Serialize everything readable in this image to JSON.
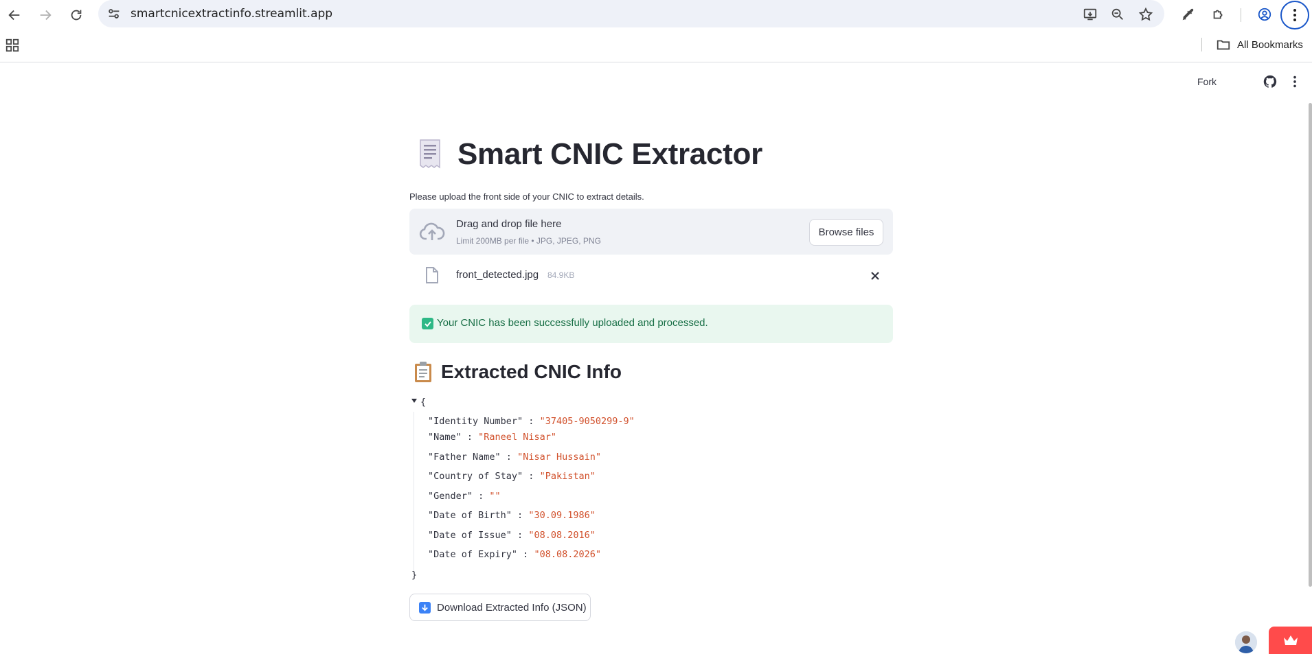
{
  "browser": {
    "url": "smartcnicextractinfo.streamlit.app",
    "bookmarks_label": "All Bookmarks"
  },
  "toolbar": {
    "fork_label": "Fork"
  },
  "page": {
    "title": "Smart CNIC Extractor",
    "subtitle": "Please upload the front side of your CNIC to extract details."
  },
  "uploader": {
    "drop_label": "Drag and drop file here",
    "limit_label": "Limit 200MB per file • JPG, JPEG, PNG",
    "browse_label": "Browse files"
  },
  "file": {
    "name": "front_detected.jpg",
    "size": "84.9KB"
  },
  "success_message": "Your CNIC has been successfully uploaded and processed.",
  "section": {
    "title": "Extracted CNIC Info"
  },
  "json": {
    "open_brace": "{",
    "close_brace": "}",
    "fields": [
      {
        "key": "\"Identity Number\"",
        "value": "\"37405-9050299-9\""
      },
      {
        "key": "\"Name\"",
        "value": "\"Raneel Nisar\""
      },
      {
        "key": "\"Father Name\"",
        "value": "\"Nisar Hussain\""
      },
      {
        "key": "\"Country of Stay\"",
        "value": "\"Pakistan\""
      },
      {
        "key": "\"Gender\"",
        "value": "\"\""
      },
      {
        "key": "\"Date of Birth\"",
        "value": "\"30.09.1986\""
      },
      {
        "key": "\"Date of Issue\"",
        "value": "\"08.08.2016\""
      },
      {
        "key": "\"Date of Expiry\"",
        "value": "\"08.08.2026\""
      }
    ]
  },
  "download": {
    "label": "Download Extracted Info (JSON)"
  },
  "colors": {
    "accent": "#ff4b4b",
    "success_bg": "#e9f7ef",
    "success_text": "#176e45",
    "json_value": "#d1502b"
  }
}
